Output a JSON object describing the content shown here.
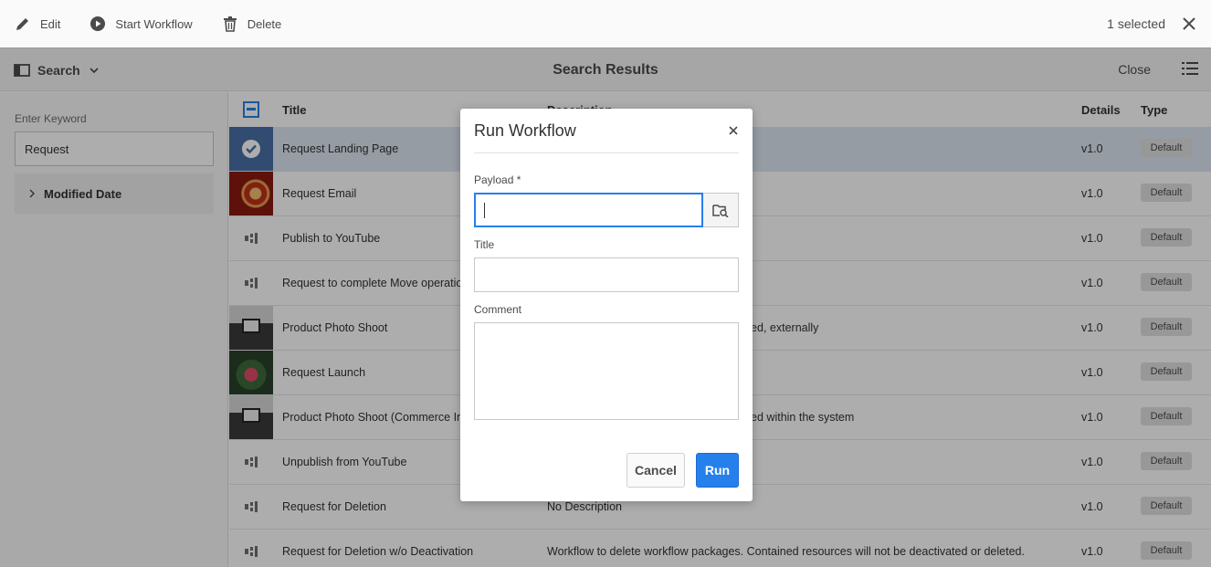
{
  "actionbar": {
    "edit_label": "Edit",
    "start_workflow_label": "Start Workflow",
    "delete_label": "Delete",
    "selected_text": "1 selected"
  },
  "header": {
    "rail_label": "Search",
    "title": "Search Results",
    "close_label": "Close"
  },
  "rail": {
    "keyword_label": "Enter Keyword",
    "keyword_value": "Request",
    "section_label": "Modified Date"
  },
  "table": {
    "columns": {
      "title": "Title",
      "description": "Description",
      "details": "Details",
      "type": "Type"
    },
    "rows": [
      {
        "title": "Request Landing Page",
        "description": "",
        "details": "v1.0",
        "type": "Default",
        "thumb": "check-icon",
        "selected": true
      },
      {
        "title": "Request Email",
        "description": "",
        "details": "v1.0",
        "type": "Default",
        "thumb": "image-red"
      },
      {
        "title": "Publish to YouTube",
        "description": "",
        "details": "v1.0",
        "type": "Default",
        "thumb": "workflow-model-icon"
      },
      {
        "title": "Request to complete Move operation",
        "description": "",
        "details": "v1.0",
        "type": "Default",
        "thumb": "workflow-model-icon"
      },
      {
        "title": "Product Photo Shoot",
        "description": "Photo shoot request for products managed, externally",
        "details": "v1.0",
        "type": "Default",
        "thumb": "image-gray"
      },
      {
        "title": "Request Launch",
        "description": "",
        "details": "v1.0",
        "type": "Default",
        "thumb": "image-green"
      },
      {
        "title": "Product Photo Shoot (Commerce Integration)",
        "description": "Photo shoot request for products managed within the system",
        "details": "v1.0",
        "type": "Default",
        "thumb": "image-gray"
      },
      {
        "title": "Unpublish from YouTube",
        "description": "",
        "details": "v1.0",
        "type": "Default",
        "thumb": "workflow-model-icon"
      },
      {
        "title": "Request for Deletion",
        "description": "No Description",
        "details": "v1.0",
        "type": "Default",
        "thumb": "workflow-model-icon"
      },
      {
        "title": "Request for Deletion w/o Deactivation",
        "description": "Workflow to delete workflow packages. Contained resources will not be deactivated or deleted.",
        "details": "v1.0",
        "type": "Default",
        "thumb": "workflow-model-icon"
      }
    ]
  },
  "dialog": {
    "title": "Run Workflow",
    "payload_label": "Payload *",
    "payload_value": "",
    "title_label": "Title",
    "title_value": "",
    "comment_label": "Comment",
    "comment_value": "",
    "cancel_label": "Cancel",
    "run_label": "Run"
  },
  "colors": {
    "accent": "#2680eb",
    "selected_row": "#dde6f2"
  }
}
